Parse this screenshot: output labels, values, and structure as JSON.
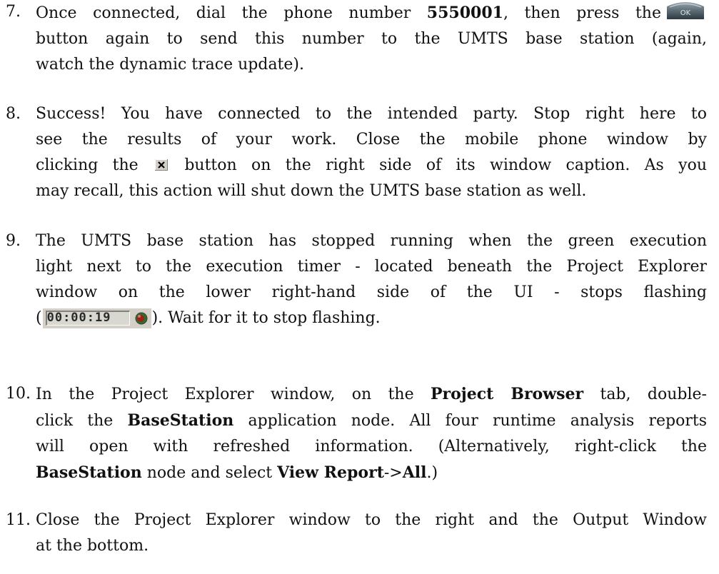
{
  "steps": [
    {
      "number": "7.",
      "parts": {
        "a": "Once connected, dial the phone number ",
        "b": "5550001",
        "c": ", then press the",
        "d": "button again to send this number to the UMTS base station (again,",
        "e": "watch the dynamic trace update)."
      },
      "icon": "ok-key-icon"
    },
    {
      "number": "8.",
      "parts": {
        "a": "Success! You have connected to the intended party. Stop right here to",
        "b": "see the results of your work. Close the mobile phone window by",
        "c": "clicking the",
        "d": "button on the right side of its window caption. As you",
        "e": "may recall, this action will shut down the UMTS base station as well."
      },
      "icon": "close-icon"
    },
    {
      "number": "9.",
      "parts": {
        "a": "The UMTS base station has stopped running when the green execution",
        "b": "light next to the execution timer - located beneath the Project Explorer",
        "c": "window on the lower right-hand side of the UI - stops flashing",
        "d": "(",
        "e": "). Wait for it to stop flashing."
      },
      "timer": {
        "value": "00:00:19",
        "light_color": "#3a8a2a"
      }
    },
    {
      "number": "10.",
      "parts": {
        "a": "In the Project Explorer window, on the ",
        "b": "Project Browser",
        "c": " tab, double-",
        "d": "click the ",
        "e": "BaseStation",
        "f": " application node. All four runtime analysis reports",
        "g": "will open with refreshed information. (Alternatively, right-click the",
        "h": "BaseStation",
        "i": " node and select ",
        "j": "View Report",
        "k": "->",
        "l": "All",
        "m": ".)"
      }
    },
    {
      "number": "11.",
      "parts": {
        "a": "Close the Project Explorer window to the right and the Output Window",
        "b": "at the bottom."
      }
    }
  ]
}
